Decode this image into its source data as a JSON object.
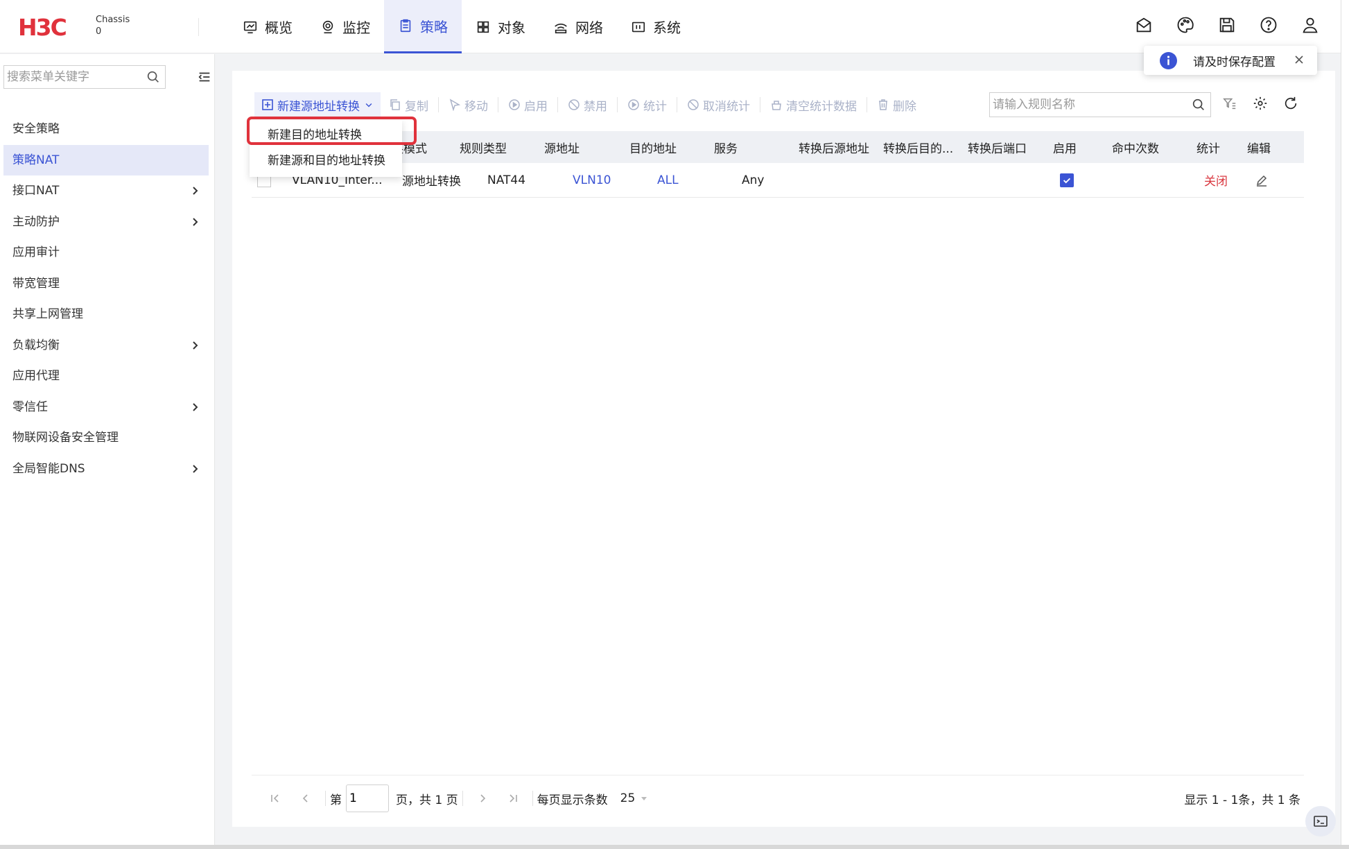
{
  "brand": {
    "logo_text": "H3C",
    "chassis_label": "Chassis",
    "chassis_value": "0",
    "color": "#e0323c"
  },
  "nav": {
    "items": [
      {
        "label": "概览",
        "icon": "overview-icon"
      },
      {
        "label": "监控",
        "icon": "monitor-icon"
      },
      {
        "label": "策略",
        "icon": "policy-icon",
        "active": true
      },
      {
        "label": "对象",
        "icon": "object-icon"
      },
      {
        "label": "网络",
        "icon": "network-icon"
      },
      {
        "label": "系统",
        "icon": "system-icon"
      }
    ],
    "right_icons": [
      "mail-icon",
      "palette-icon",
      "save-icon",
      "help-icon",
      "user-icon"
    ]
  },
  "sidebar": {
    "search_placeholder": "搜索菜单关键字",
    "items": [
      {
        "label": "安全策略",
        "has_children": false
      },
      {
        "label": "策略NAT",
        "has_children": false,
        "active": true
      },
      {
        "label": "接口NAT",
        "has_children": true
      },
      {
        "label": "主动防护",
        "has_children": true
      },
      {
        "label": "应用审计",
        "has_children": false
      },
      {
        "label": "带宽管理",
        "has_children": false
      },
      {
        "label": "共享上网管理",
        "has_children": false
      },
      {
        "label": "负载均衡",
        "has_children": true
      },
      {
        "label": "应用代理",
        "has_children": false
      },
      {
        "label": "零信任",
        "has_children": true
      },
      {
        "label": "物联网设备安全管理",
        "has_children": false
      },
      {
        "label": "全局智能DNS",
        "has_children": true
      }
    ]
  },
  "toolbar": {
    "new_label": "新建源地址转换",
    "copy_label": "复制",
    "move_label": "移动",
    "enable_label": "启用",
    "disable_label": "禁用",
    "stats_label": "统计",
    "cancel_stats_label": "取消统计",
    "clear_stats_label": "清空统计数据",
    "delete_label": "删除",
    "search_placeholder": "请输入规则名称"
  },
  "dropdown": {
    "items": [
      "新建目的地址转换",
      "新建源和目的地址转换"
    ],
    "highlighted_index": 0
  },
  "table": {
    "headers": {
      "mode": "转换模式",
      "rule_type": "规则类型",
      "src": "源地址",
      "dst": "目的地址",
      "service": "服务",
      "post_src": "转换后源地址",
      "post_dst": "转换后目的...",
      "post_port": "转换后端口",
      "enabled": "启用",
      "hits": "命中次数",
      "stats": "统计",
      "edit": "编辑"
    },
    "rows": [
      {
        "name": "VLAN10_Inter...",
        "mode": "源地址转换",
        "rule_type": "NAT44",
        "src": "VLN10",
        "dst": "ALL",
        "service": "Any",
        "post_src": "",
        "post_dst": "",
        "post_port": "",
        "enabled": true,
        "hits": "",
        "stats": "关闭"
      }
    ]
  },
  "pager": {
    "prefix": "第",
    "page": "1",
    "suffix": "页，共 1 页",
    "page_size_label": "每页显示条数",
    "page_size": "25",
    "summary": "显示 1 - 1条，共 1 条"
  },
  "toast": {
    "message": "请及时保存配置"
  },
  "colors": {
    "accent": "#3b54d4",
    "danger": "#d9363e"
  }
}
